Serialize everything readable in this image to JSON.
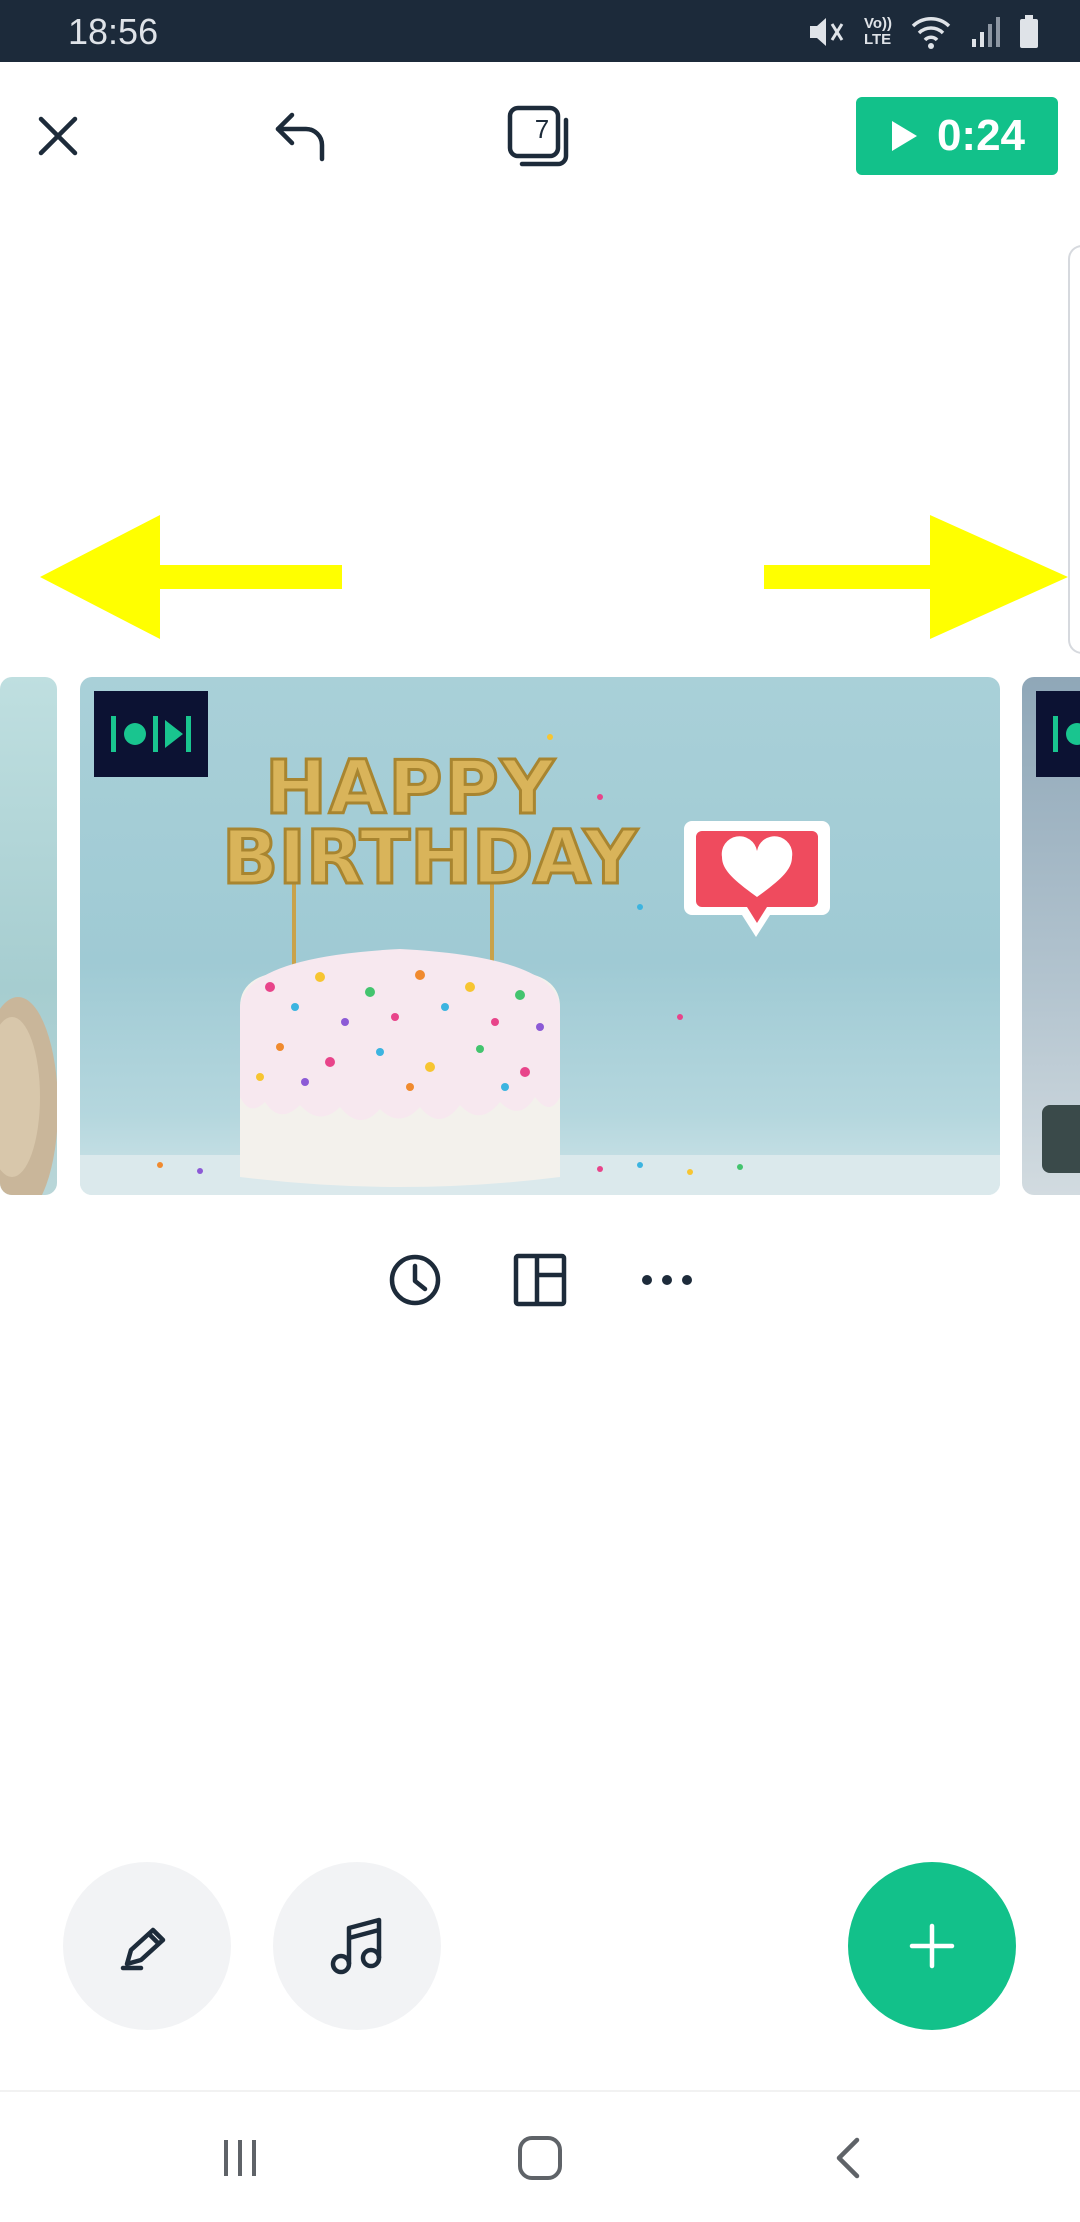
{
  "status_bar": {
    "time": "18:56",
    "icons": [
      "mute-icon",
      "volte-icon",
      "wifi-icon",
      "signal-icon",
      "battery-icon"
    ],
    "volte_label_top": "Vo))",
    "volte_label_bottom": "LTE"
  },
  "toolbar": {
    "close_icon": "close-icon",
    "undo_icon": "undo-icon",
    "slide_count": "7",
    "play_duration": "0:24"
  },
  "overlay_arrows": {
    "color": "#ffff00",
    "left": "left-arrow",
    "right": "right-arrow"
  },
  "slides": {
    "current": {
      "image": "birthday-cake-photo",
      "image_text_line1": "HAPPY",
      "image_text_line2": "BIRTHDAY",
      "sticker": "heart-speech-bubble"
    }
  },
  "slide_actions": [
    "clock-icon",
    "layout-icon",
    "more-icon"
  ],
  "bottom_actions": {
    "style_icon": "pen-icon",
    "music_icon": "music-note-icon",
    "add_icon": "plus-icon"
  },
  "colors": {
    "accent": "#12c18a",
    "status_bar_bg": "#1c2a3a",
    "badge_bg": "#0c1233"
  }
}
